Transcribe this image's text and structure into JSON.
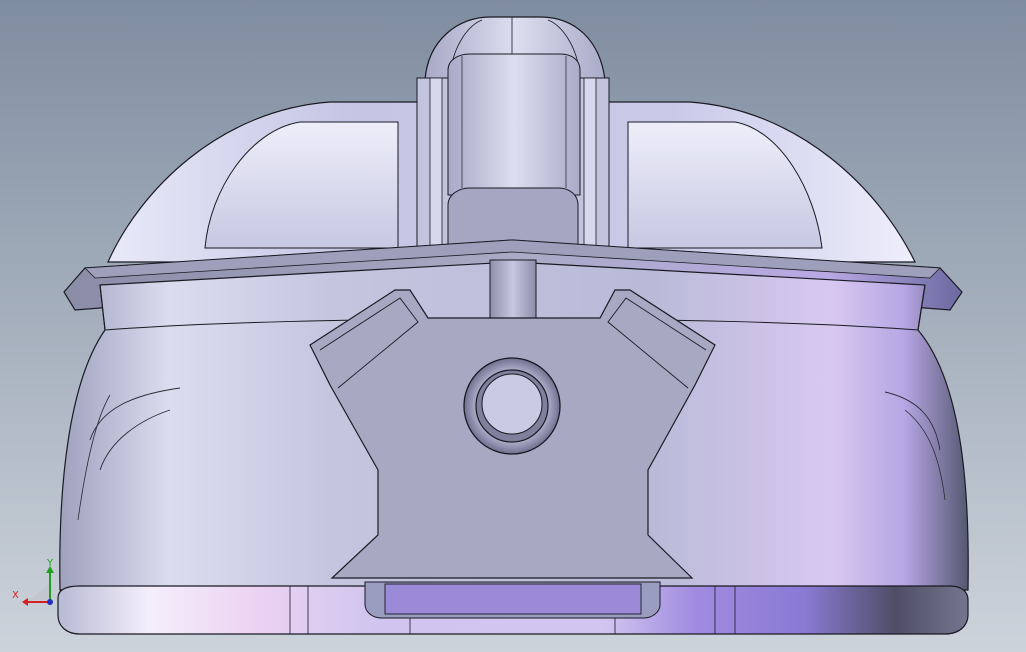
{
  "viewport": {
    "background_top": "#7f8da0",
    "background_bottom": "#cdd3db"
  },
  "model": {
    "body_light": "#d6d9ee",
    "body_mid": "#aeb1cc",
    "body_shadow": "#5a5c75",
    "accent_purple": "#9e84e0",
    "accent_pink": "#efd6f3",
    "bracket_fill": "#a7a9c3",
    "edge_color": "#1a1a22"
  },
  "triad": {
    "x_label": "X",
    "y_label": "Y",
    "x_color": "#d42020",
    "y_color": "#20a020",
    "z_color": "#2030c0"
  }
}
